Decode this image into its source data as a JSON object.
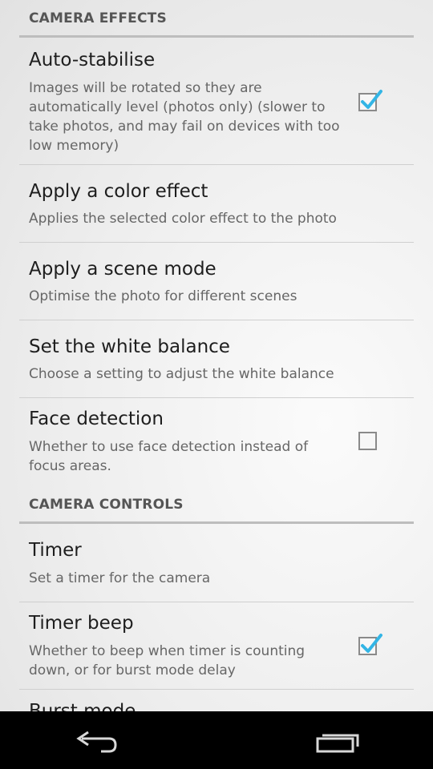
{
  "sections": {
    "camera_effects": "CAMERA EFFECTS",
    "camera_controls": "CAMERA CONTROLS"
  },
  "prefs": {
    "auto_stabilise": {
      "title": "Auto-stabilise",
      "summary": "Images will be rotated so they are automatically level (photos only) (slower to take photos, and may fail on devices with too low memory)",
      "checked": true
    },
    "color_effect": {
      "title": "Apply a color effect",
      "summary": "Applies the selected color effect to the photo"
    },
    "scene_mode": {
      "title": "Apply a scene mode",
      "summary": "Optimise the photo for different scenes"
    },
    "white_balance": {
      "title": "Set the white balance",
      "summary": "Choose a setting to adjust the white balance"
    },
    "face_detection": {
      "title": "Face detection",
      "summary": "Whether to use face detection instead of focus areas.",
      "checked": false
    },
    "timer": {
      "title": "Timer",
      "summary": "Set a timer for the camera"
    },
    "timer_beep": {
      "title": "Timer beep",
      "summary": "Whether to beep when timer is counting down, or for burst mode delay",
      "checked": true
    },
    "burst_mode": {
      "title": "Burst mode"
    }
  },
  "navbar": {
    "back": "back-icon",
    "recents": "recent-apps-icon"
  },
  "colors": {
    "accent": "#33b5e5"
  }
}
